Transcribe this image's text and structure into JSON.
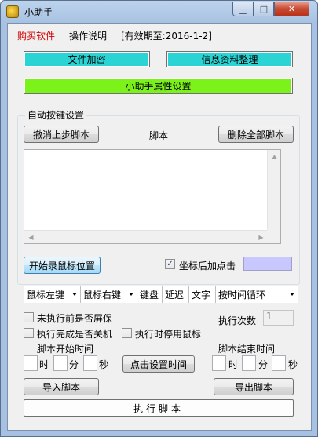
{
  "window": {
    "title": "小助手",
    "minimize_glyph": "▁",
    "maximize_glyph": "□",
    "close_glyph": "✕"
  },
  "menu": {
    "buy": "购买软件",
    "help": "操作说明",
    "valid_until": "[有效期至:2016-1-2]"
  },
  "top_buttons": {
    "file_encrypt": "文件加密",
    "info_organize": "信息资料整理",
    "properties": "小助手属性设置"
  },
  "autokey": {
    "group_title": "自动按键设置",
    "undo_button": "撤消上步脚本",
    "script_label": "脚本",
    "delete_all_button": "删除全部脚本",
    "record_mouse_button": "开始录鼠标位置",
    "click_after_coord_label": "坐标后加点击",
    "click_after_coord_checked": "✓"
  },
  "toolbar": {
    "left_click": "鼠标左键",
    "right_click": "鼠标右键",
    "keyboard": "键盘",
    "delay": "延迟",
    "text": "文字",
    "loop_select": "按时间循环"
  },
  "options": {
    "screensaver_check": "未执行前是否屏保",
    "shutdown_check": "执行完成是否关机",
    "disable_mouse_check": "执行时停用鼠标",
    "exec_count_label": "执行次数",
    "exec_count_value": "1"
  },
  "schedule": {
    "start_label": "脚本开始时间",
    "end_label": "脚本结束时间",
    "hour": "时",
    "minute": "分",
    "second": "秒",
    "set_time_button": "点击设置时间"
  },
  "bottom": {
    "import_button": "导入脚本",
    "export_button": "导出脚本",
    "execute_button": "执行脚本"
  },
  "colors": {
    "cyan": "#2ad4d4",
    "green": "#7bf21a",
    "buy_red": "#d40000",
    "coord_color": "#c8c8ff"
  }
}
